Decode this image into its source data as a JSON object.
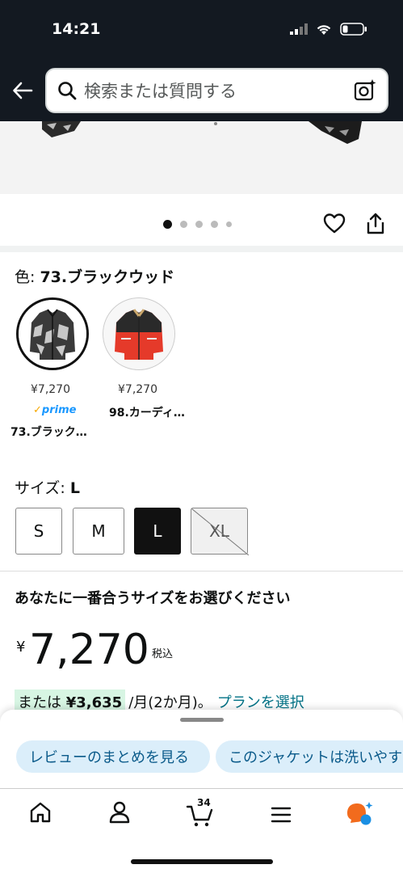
{
  "status_bar": {
    "time": "14:21"
  },
  "search": {
    "placeholder": "検索または質問する"
  },
  "carousel": {
    "total": 5,
    "current": 1
  },
  "color": {
    "label": "色: ",
    "selected_value": "73.ブラックウッド",
    "options": [
      {
        "price": "¥7,270",
        "prime": "prime",
        "name": "73.ブラック…"
      },
      {
        "price": "¥7,270",
        "name": "98.カーディ…"
      }
    ]
  },
  "size": {
    "label": "サイズ: ",
    "selected_value": "L",
    "options": [
      "S",
      "M",
      "L",
      "XL"
    ]
  },
  "fit": {
    "title": "あなたに一番合うサイズをお選びください"
  },
  "price": {
    "currency": "¥",
    "amount": "7,270",
    "tax_note": "税込"
  },
  "installment": {
    "prefix": "または",
    "amount": "¥3,635",
    "suffix": "/月(2か月)。",
    "link": "プランを選択"
  },
  "sheet": {
    "chips": [
      "レビューのまとめを見る",
      "このジャケットは洗いやす"
    ]
  },
  "bottom_nav": {
    "cart_count": "34"
  },
  "colors": {
    "header_bg": "#131921",
    "link": "#007185",
    "chip_bg": "#dbeefa",
    "installment_hl": "#d7f5e3"
  }
}
